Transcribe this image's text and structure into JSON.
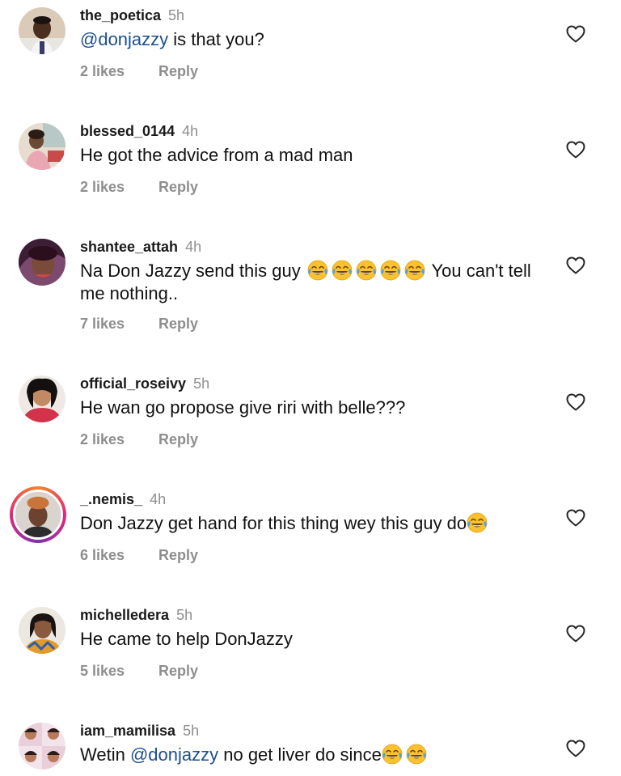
{
  "comments": [
    {
      "username": "the_poetica",
      "time": "5h",
      "mention": "@donjazzy",
      "text": " is that you?",
      "likes": "2 likes",
      "reply": "Reply"
    },
    {
      "username": "blessed_0144",
      "time": "4h",
      "text": "He got the advice from a mad man",
      "likes": "2 likes",
      "reply": "Reply"
    },
    {
      "username": "shantee_attah",
      "time": "4h",
      "text_before": "Na Don Jazzy send this guy ",
      "text_after": " You can't tell me nothing..",
      "emoji_count": 5,
      "likes": "7 likes",
      "reply": "Reply"
    },
    {
      "username": "official_roseivy",
      "time": "5h",
      "text": "He wan go propose give riri with belle???",
      "likes": "2 likes",
      "reply": "Reply"
    },
    {
      "username": "_.nemis_",
      "time": "4h",
      "text": "Don Jazzy get hand for this thing wey this guy do",
      "emoji_count": 1,
      "likes": "6 likes",
      "reply": "Reply"
    },
    {
      "username": "michelledera",
      "time": "5h",
      "text": "He came to help DonJazzy",
      "likes": "5 likes",
      "reply": "Reply"
    },
    {
      "username": "iam_mamilisa",
      "time": "5h",
      "text_before": "Wetin ",
      "mention": "@donjazzy",
      "text_after": " no get liver do since",
      "emoji_count": 2
    }
  ],
  "icons": {
    "like": "heart-outline-icon",
    "emoji": "face-with-tears-of-joy-emoji"
  },
  "colors": {
    "mention": "#1d4f8c",
    "muted": "#8e8e8e",
    "text": "#111111"
  }
}
